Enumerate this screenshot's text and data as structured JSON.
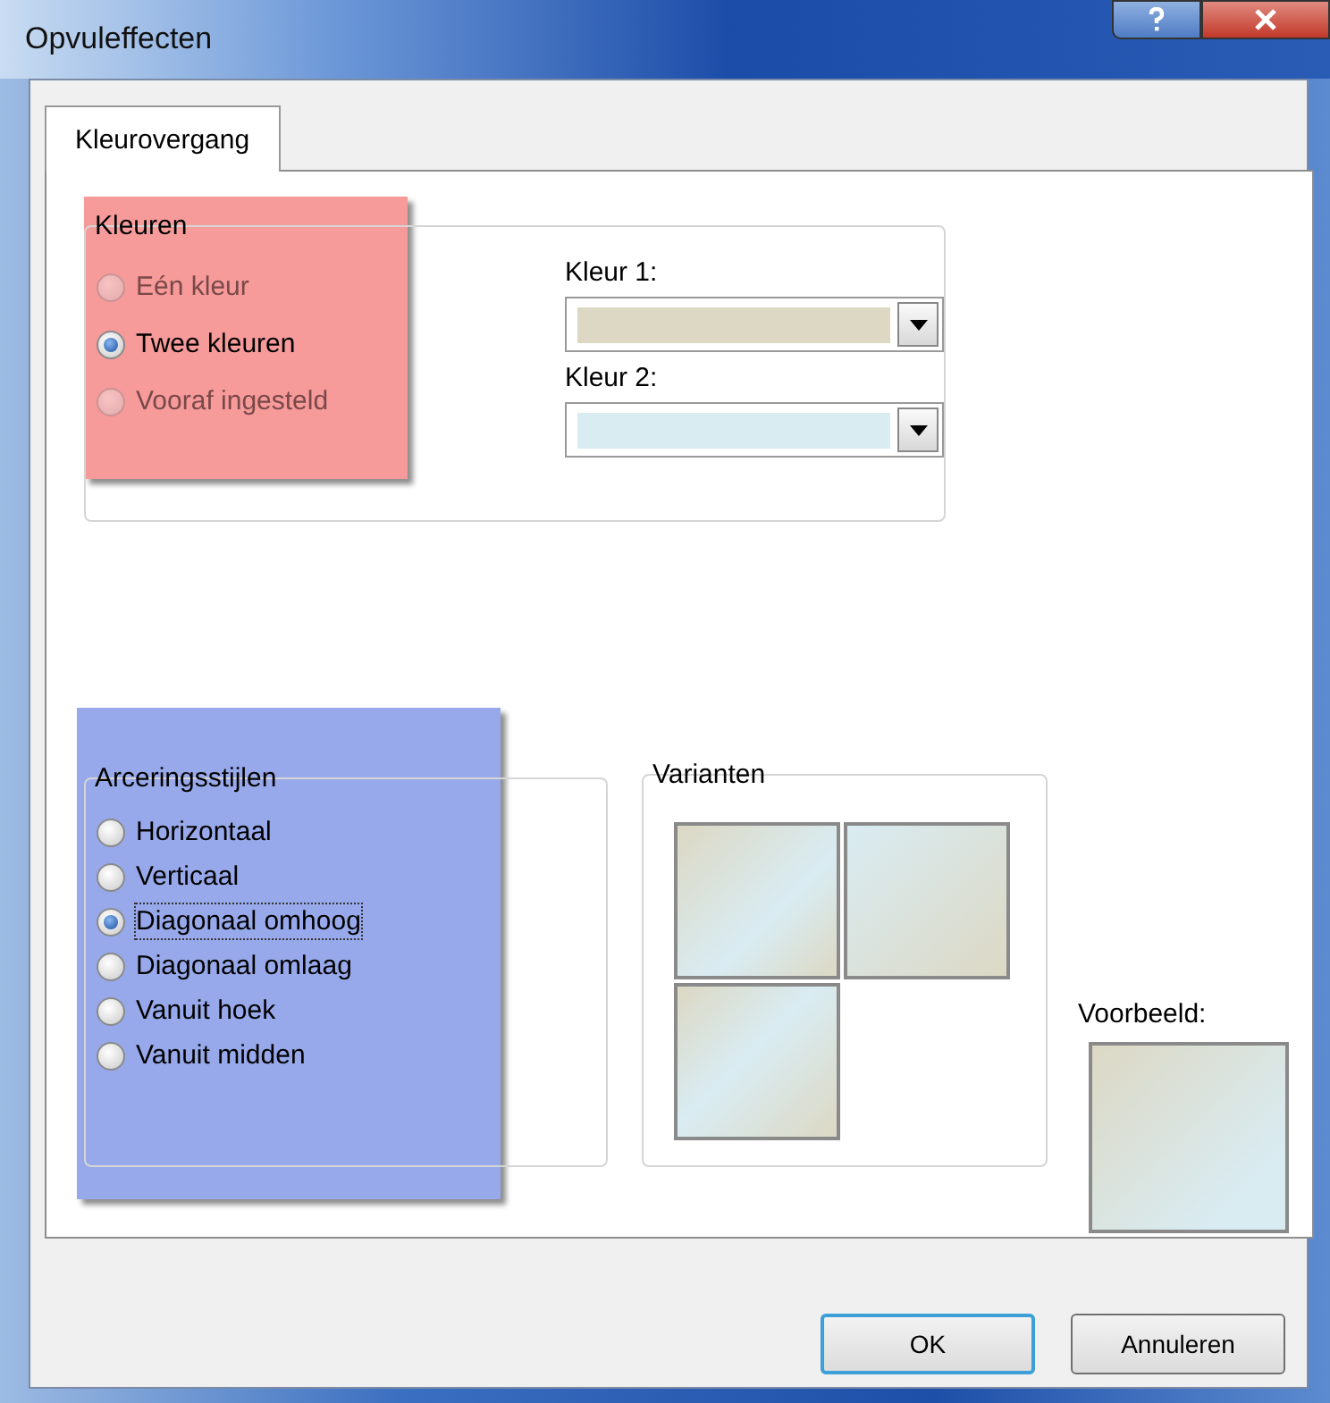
{
  "window": {
    "title": "Opvuleffecten"
  },
  "tabs": [
    {
      "label": "Kleurovergang",
      "selected": true
    }
  ],
  "colors_group": {
    "title": "Kleuren",
    "options": [
      {
        "label": "Eén kleur",
        "selected": false,
        "disabled": true
      },
      {
        "label": "Twee kleuren",
        "selected": true,
        "disabled": false
      },
      {
        "label": "Vooraf ingesteld",
        "selected": false,
        "disabled": true
      }
    ],
    "pickers": [
      {
        "label": "Kleur 1:",
        "color": "#dcd8c4"
      },
      {
        "label": "Kleur 2:",
        "color": "#d9ecf2"
      }
    ]
  },
  "shading_group": {
    "title": "Arceringsstijlen",
    "options": [
      {
        "label": "Horizontaal",
        "selected": false
      },
      {
        "label": "Verticaal",
        "selected": false
      },
      {
        "label": "Diagonaal omhoog",
        "selected": true
      },
      {
        "label": "Diagonaal omlaag",
        "selected": false
      },
      {
        "label": "Vanuit hoek",
        "selected": false
      },
      {
        "label": "Vanuit midden",
        "selected": false
      }
    ]
  },
  "variants_group": {
    "title": "Varianten"
  },
  "preview": {
    "label": "Voorbeeld:"
  },
  "annotations": [
    {
      "color": "#f69a9a"
    },
    {
      "color": "#97a9ea"
    }
  ],
  "buttons": [
    {
      "label": "OK",
      "default": true
    },
    {
      "label": "Annuleren",
      "default": false
    }
  ]
}
